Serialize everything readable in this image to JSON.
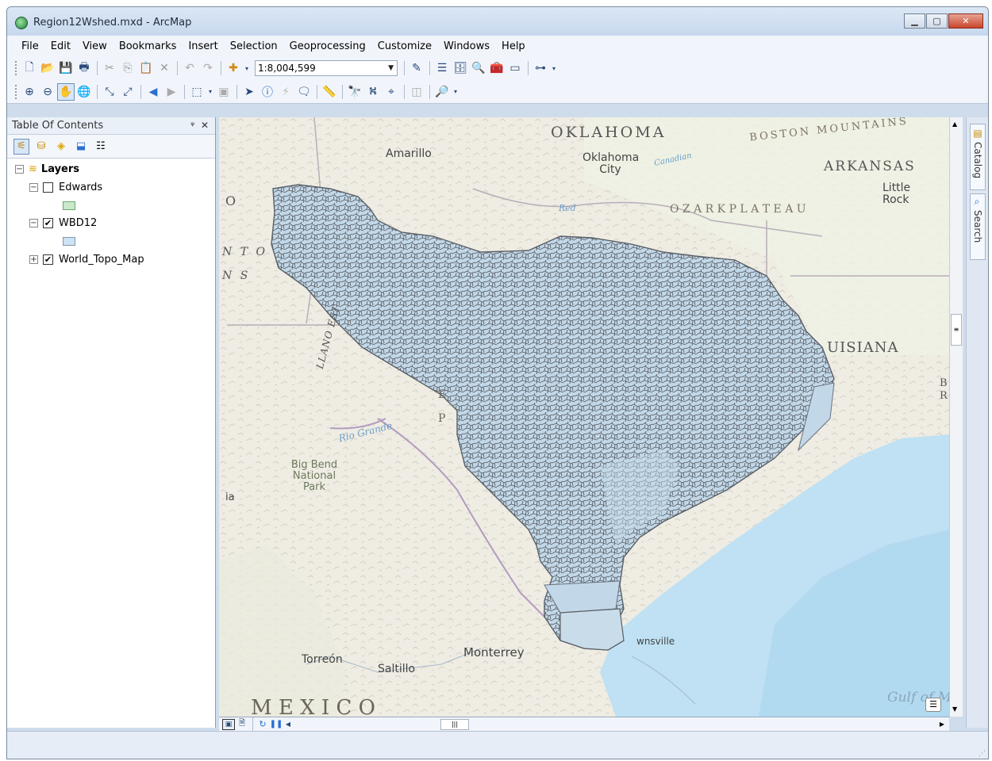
{
  "window": {
    "title": "Region12Wshed.mxd - ArcMap"
  },
  "menu": [
    "File",
    "Edit",
    "View",
    "Bookmarks",
    "Insert",
    "Selection",
    "Geoprocessing",
    "Customize",
    "Windows",
    "Help"
  ],
  "toolbar": {
    "scale_value": "1:8,004,599"
  },
  "toc": {
    "title": "Table Of Contents",
    "root_label": "Layers",
    "layers": [
      {
        "name": "Edwards",
        "checked": false,
        "expander": "⊟",
        "swatch": "#c9e8cc"
      },
      {
        "name": "WBD12",
        "checked": true,
        "expander": "⊟",
        "swatch": "#cde2f2"
      },
      {
        "name": "World_Topo_Map",
        "checked": true,
        "expander": "⊞"
      }
    ]
  },
  "dock": {
    "catalog": "Catalog",
    "search": "Search"
  },
  "map": {
    "labels": {
      "oklahoma": "OKLAHOMA",
      "amarillo": "Amarillo",
      "okc": "Oklahoma City",
      "canadian": "Canadian",
      "boston_mtns": "BOSTON MOUNTAINS",
      "arkansas": "ARKANSAS",
      "little_rock": "Little Rock",
      "red": "Red",
      "ozark": "O Z A R K   P L A T E A U",
      "nto": "N T O",
      "ns": "N S",
      "o": "O",
      "llano": "LLANO EST",
      "louisiana": "UISIANA",
      "rio_grande": "Rio Grande",
      "big_bend": "Big Bend National Park",
      "ia": "ia",
      "torreon": "Torreón",
      "saltillo": "Saltillo",
      "monterrey": "Monterrey",
      "brownsville": "wnsville",
      "mexico": "M E X I C O",
      "gulf": "Gulf of M",
      "ep1": "E",
      "ep2": "P",
      "br1": "B",
      "br2": "R"
    }
  },
  "colors": {
    "watershed_fill": "#c2d8e8",
    "watershed_line": "#5a5f66",
    "water": "#bfe1f3"
  }
}
